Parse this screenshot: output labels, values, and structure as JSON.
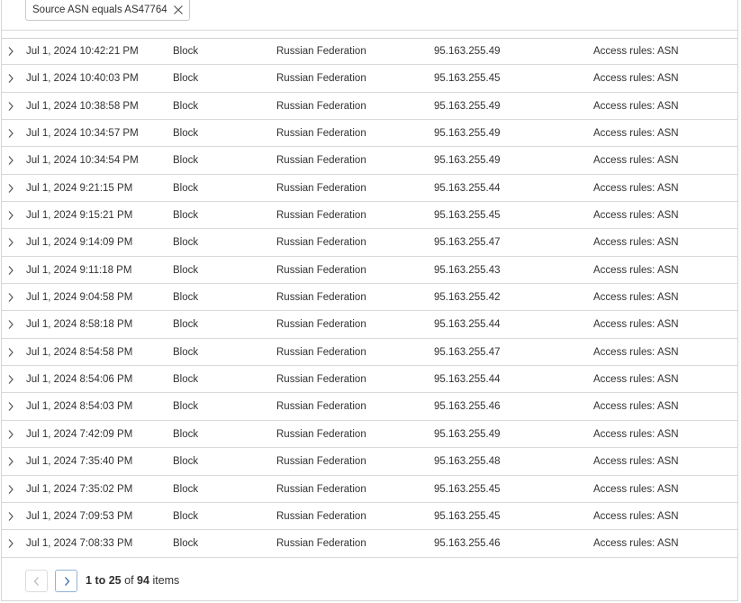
{
  "filter": {
    "chip_label": "Source ASN equals AS47764",
    "close_icon": "close-icon"
  },
  "rows": [
    {
      "date": "Jul 1, 2024 10:42:21 PM",
      "action": "Block",
      "country": "Russian Federation",
      "ip": "95.163.255.49",
      "service": "Access rules: ASN"
    },
    {
      "date": "Jul 1, 2024 10:40:03 PM",
      "action": "Block",
      "country": "Russian Federation",
      "ip": "95.163.255.45",
      "service": "Access rules: ASN"
    },
    {
      "date": "Jul 1, 2024 10:38:58 PM",
      "action": "Block",
      "country": "Russian Federation",
      "ip": "95.163.255.49",
      "service": "Access rules: ASN"
    },
    {
      "date": "Jul 1, 2024 10:34:57 PM",
      "action": "Block",
      "country": "Russian Federation",
      "ip": "95.163.255.49",
      "service": "Access rules: ASN"
    },
    {
      "date": "Jul 1, 2024 10:34:54 PM",
      "action": "Block",
      "country": "Russian Federation",
      "ip": "95.163.255.49",
      "service": "Access rules: ASN"
    },
    {
      "date": "Jul 1, 2024 9:21:15 PM",
      "action": "Block",
      "country": "Russian Federation",
      "ip": "95.163.255.44",
      "service": "Access rules: ASN"
    },
    {
      "date": "Jul 1, 2024 9:15:21 PM",
      "action": "Block",
      "country": "Russian Federation",
      "ip": "95.163.255.45",
      "service": "Access rules: ASN"
    },
    {
      "date": "Jul 1, 2024 9:14:09 PM",
      "action": "Block",
      "country": "Russian Federation",
      "ip": "95.163.255.47",
      "service": "Access rules: ASN"
    },
    {
      "date": "Jul 1, 2024 9:11:18 PM",
      "action": "Block",
      "country": "Russian Federation",
      "ip": "95.163.255.43",
      "service": "Access rules: ASN"
    },
    {
      "date": "Jul 1, 2024 9:04:58 PM",
      "action": "Block",
      "country": "Russian Federation",
      "ip": "95.163.255.42",
      "service": "Access rules: ASN"
    },
    {
      "date": "Jul 1, 2024 8:58:18 PM",
      "action": "Block",
      "country": "Russian Federation",
      "ip": "95.163.255.44",
      "service": "Access rules: ASN"
    },
    {
      "date": "Jul 1, 2024 8:54:58 PM",
      "action": "Block",
      "country": "Russian Federation",
      "ip": "95.163.255.47",
      "service": "Access rules: ASN"
    },
    {
      "date": "Jul 1, 2024 8:54:06 PM",
      "action": "Block",
      "country": "Russian Federation",
      "ip": "95.163.255.44",
      "service": "Access rules: ASN"
    },
    {
      "date": "Jul 1, 2024 8:54:03 PM",
      "action": "Block",
      "country": "Russian Federation",
      "ip": "95.163.255.46",
      "service": "Access rules: ASN"
    },
    {
      "date": "Jul 1, 2024 7:42:09 PM",
      "action": "Block",
      "country": "Russian Federation",
      "ip": "95.163.255.49",
      "service": "Access rules: ASN"
    },
    {
      "date": "Jul 1, 2024 7:35:40 PM",
      "action": "Block",
      "country": "Russian Federation",
      "ip": "95.163.255.48",
      "service": "Access rules: ASN"
    },
    {
      "date": "Jul 1, 2024 7:35:02 PM",
      "action": "Block",
      "country": "Russian Federation",
      "ip": "95.163.255.45",
      "service": "Access rules: ASN"
    },
    {
      "date": "Jul 1, 2024 7:09:53 PM",
      "action": "Block",
      "country": "Russian Federation",
      "ip": "95.163.255.45",
      "service": "Access rules: ASN"
    },
    {
      "date": "Jul 1, 2024 7:08:33 PM",
      "action": "Block",
      "country": "Russian Federation",
      "ip": "95.163.255.46",
      "service": "Access rules: ASN"
    }
  ],
  "pagination": {
    "range_start": "1",
    "to_text": "to",
    "range_end": "25",
    "of_text": "of",
    "total": "94",
    "items_text": "items",
    "prev_icon": "chevron-left-icon",
    "next_icon": "chevron-right-icon"
  },
  "colors": {
    "text": "#313131",
    "border": "#d9d9d9",
    "icon": "#555555",
    "next_button_border": "#8fb3d9"
  }
}
